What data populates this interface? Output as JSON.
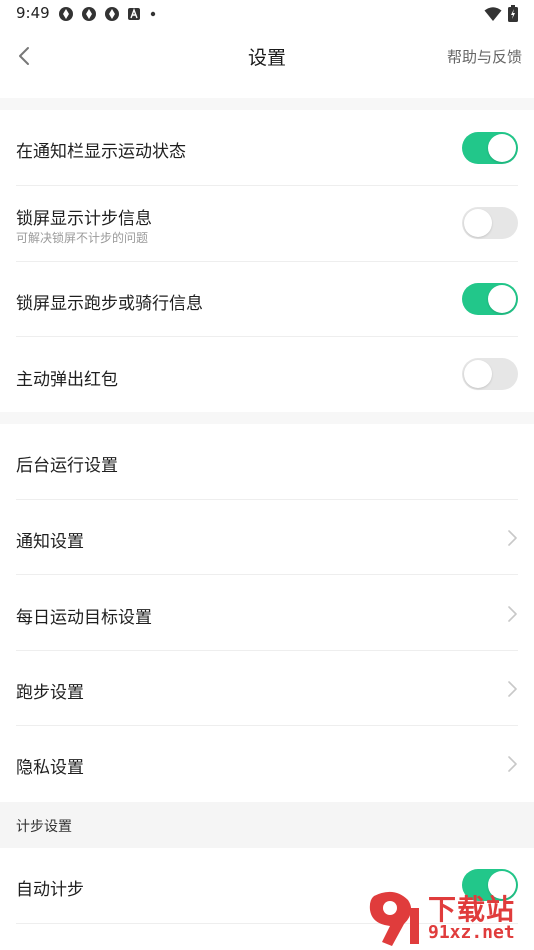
{
  "status": {
    "time": "9:49",
    "icons": [
      "app-icon",
      "app-icon",
      "app-icon",
      "a-badge-icon",
      "dot-icon"
    ],
    "right_icons": [
      "wifi-icon",
      "battery-charging-icon"
    ]
  },
  "navbar": {
    "title": "设置",
    "help": "帮助与反馈",
    "back_icon": "chevron-left-icon"
  },
  "group1": [
    {
      "label": "在通知栏显示运动状态",
      "toggle": true
    },
    {
      "label": "锁屏显示计步信息",
      "sub": "可解决锁屏不计步的问题",
      "toggle": false
    },
    {
      "label": "锁屏显示跑步或骑行信息",
      "toggle": true
    },
    {
      "label": "主动弹出红包",
      "toggle": false
    }
  ],
  "group2": [
    {
      "label": "后台运行设置",
      "chevron": false
    },
    {
      "label": "通知设置",
      "chevron": true
    },
    {
      "label": "每日运动目标设置",
      "chevron": true
    },
    {
      "label": "跑步设置",
      "chevron": true
    },
    {
      "label": "隐私设置",
      "chevron": true
    }
  ],
  "section_step": {
    "header": "计步设置",
    "items": [
      {
        "label": "自动计步",
        "toggle": true
      }
    ]
  },
  "watermark": {
    "text": "下载站",
    "url": "91xz.net",
    "mark": "9f"
  },
  "colors": {
    "accent": "#22c78a",
    "toggle_off": "#e6e6e6",
    "watermark": "#e03c3c"
  }
}
